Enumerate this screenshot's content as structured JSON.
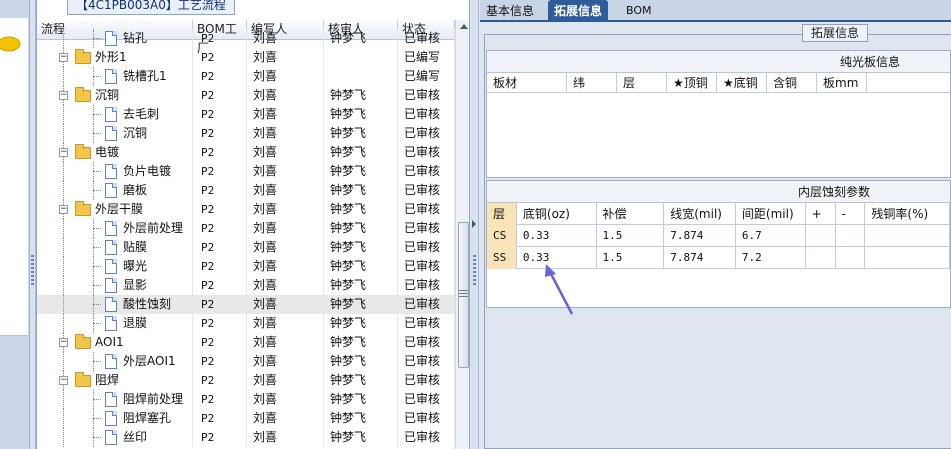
{
  "mid_title": "【4C1PB003A0】工艺流程",
  "tree_columns": [
    "流程",
    "BOM工厂",
    "编写人",
    "核审人",
    "状态"
  ],
  "tree_rows": [
    {
      "type": "leaf",
      "label": "钻孔",
      "bom": "P2",
      "writer": "刘喜",
      "reviewer": "钟梦飞",
      "status": "已审核",
      "partial": true
    },
    {
      "type": "group",
      "label": "外形1",
      "bom": "P2",
      "writer": "刘喜",
      "reviewer": "",
      "status": "已编写"
    },
    {
      "type": "leaf",
      "label": "铣槽孔1",
      "bom": "P2",
      "writer": "刘喜",
      "reviewer": "",
      "status": "已编写"
    },
    {
      "type": "group",
      "label": "沉铜",
      "bom": "P2",
      "writer": "刘喜",
      "reviewer": "钟梦飞",
      "status": "已审核"
    },
    {
      "type": "leaf",
      "label": "去毛刺",
      "bom": "P2",
      "writer": "刘喜",
      "reviewer": "钟梦飞",
      "status": "已审核"
    },
    {
      "type": "leaf",
      "label": "沉铜",
      "bom": "P2",
      "writer": "刘喜",
      "reviewer": "钟梦飞",
      "status": "已审核"
    },
    {
      "type": "group",
      "label": "电镀",
      "bom": "P2",
      "writer": "刘喜",
      "reviewer": "钟梦飞",
      "status": "已审核"
    },
    {
      "type": "leaf",
      "label": "负片电镀",
      "bom": "P2",
      "writer": "刘喜",
      "reviewer": "钟梦飞",
      "status": "已审核"
    },
    {
      "type": "leaf",
      "label": "磨板",
      "bom": "P2",
      "writer": "刘喜",
      "reviewer": "钟梦飞",
      "status": "已审核"
    },
    {
      "type": "group",
      "label": "外层干膜",
      "bom": "P2",
      "writer": "刘喜",
      "reviewer": "钟梦飞",
      "status": "已审核"
    },
    {
      "type": "leaf",
      "label": "外层前处理",
      "bom": "P2",
      "writer": "刘喜",
      "reviewer": "钟梦飞",
      "status": "已审核"
    },
    {
      "type": "leaf",
      "label": "贴膜",
      "bom": "P2",
      "writer": "刘喜",
      "reviewer": "钟梦飞",
      "status": "已审核"
    },
    {
      "type": "leaf",
      "label": "曝光",
      "bom": "P2",
      "writer": "刘喜",
      "reviewer": "钟梦飞",
      "status": "已审核"
    },
    {
      "type": "leaf",
      "label": "显影",
      "bom": "P2",
      "writer": "刘喜",
      "reviewer": "钟梦飞",
      "status": "已审核"
    },
    {
      "type": "leaf",
      "label": "酸性蚀刻",
      "bom": "P2",
      "writer": "刘喜",
      "reviewer": "钟梦飞",
      "status": "已审核",
      "selected": true
    },
    {
      "type": "leaf",
      "label": "退膜",
      "bom": "P2",
      "writer": "刘喜",
      "reviewer": "钟梦飞",
      "status": "已审核"
    },
    {
      "type": "group",
      "label": "AOI1",
      "bom": "P2",
      "writer": "刘喜",
      "reviewer": "钟梦飞",
      "status": "已审核"
    },
    {
      "type": "leaf",
      "label": "外层AOI1",
      "bom": "P2",
      "writer": "刘喜",
      "reviewer": "钟梦飞",
      "status": "已审核"
    },
    {
      "type": "group",
      "label": "阻焊",
      "bom": "P2",
      "writer": "刘喜",
      "reviewer": "钟梦飞",
      "status": "已审核"
    },
    {
      "type": "leaf",
      "label": "阻焊前处理",
      "bom": "P2",
      "writer": "刘喜",
      "reviewer": "钟梦飞",
      "status": "已审核"
    },
    {
      "type": "leaf",
      "label": "阻焊塞孔",
      "bom": "P2",
      "writer": "刘喜",
      "reviewer": "钟梦飞",
      "status": "已审核"
    },
    {
      "type": "leaf",
      "label": "丝印",
      "bom": "P2",
      "writer": "刘喜",
      "reviewer": "钟梦飞",
      "status": "已审核"
    }
  ],
  "tabs": [
    {
      "label": "基本信息",
      "active": false
    },
    {
      "label": "拓展信息",
      "active": true
    },
    {
      "label": "BOM",
      "active": false
    }
  ],
  "ext_label": "拓展信息",
  "bare_board": {
    "title": "纯光板信息",
    "columns": [
      {
        "label": "板材",
        "w": 80
      },
      {
        "label": "纬",
        "w": 50
      },
      {
        "label": "层",
        "w": 50
      },
      {
        "label": "★顶铜",
        "w": 50
      },
      {
        "label": "★底铜",
        "w": 50
      },
      {
        "label": "含铜",
        "w": 50
      },
      {
        "label": "板mm",
        "w": 50
      }
    ]
  },
  "inner_layer": {
    "title": "内层蚀刻参数",
    "columns": [
      "层",
      "底铜(oz)",
      "补偿",
      "线宽(mil)",
      "间距(mil)",
      "+",
      "-",
      "残铜率(%)"
    ],
    "rows": [
      [
        "CS",
        "0.33",
        "1.5",
        "7.874",
        "6.7",
        "",
        "",
        ""
      ],
      [
        "SS",
        "0.33",
        "1.5",
        "7.874",
        "7.2",
        "",
        "",
        ""
      ]
    ]
  },
  "colors": {
    "active_tab": "#2e5c9a",
    "layer_cell": "#f8e4b8",
    "folder": "#f3c64a",
    "arrow": "#6a63d8"
  }
}
